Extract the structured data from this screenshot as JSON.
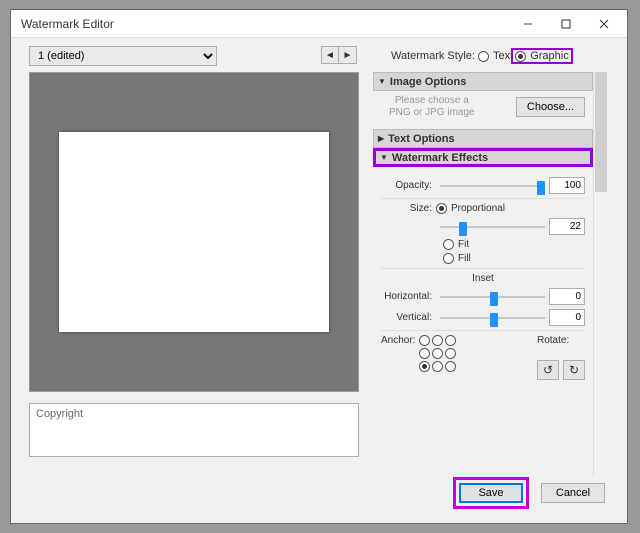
{
  "window": {
    "title": "Watermark Editor"
  },
  "preset": {
    "selected": "1 (edited)"
  },
  "style": {
    "label": "Watermark Style:",
    "text_label": "Text",
    "graphic_label": "Graphic",
    "selected": "graphic"
  },
  "copyright": {
    "placeholder": "Copyright"
  },
  "sections": {
    "image_options": {
      "title": "Image Options",
      "hint1": "Please choose a",
      "hint2": "PNG or JPG image",
      "choose": "Choose..."
    },
    "text_options": {
      "title": "Text Options"
    },
    "effects": {
      "title": "Watermark Effects",
      "opacity": {
        "label": "Opacity:",
        "value": "100"
      },
      "size": {
        "label": "Size:",
        "proportional": "Proportional",
        "fit": "Fit",
        "fill": "Fill",
        "value": "22"
      },
      "inset": {
        "label": "Inset",
        "horizontal": {
          "label": "Horizontal:",
          "value": "0"
        },
        "vertical": {
          "label": "Vertical:",
          "value": "0"
        }
      },
      "anchor": {
        "label": "Anchor:"
      },
      "rotate": {
        "label": "Rotate:"
      }
    }
  },
  "buttons": {
    "save": "Save",
    "cancel": "Cancel"
  }
}
